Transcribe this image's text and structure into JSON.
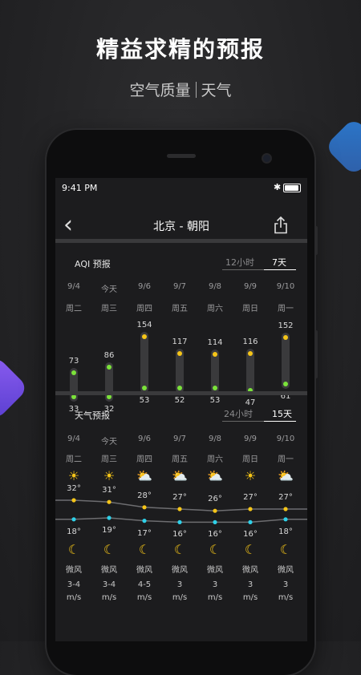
{
  "promo": {
    "headline": "精益求精的预报",
    "sub_left": "空气质量",
    "sub_right": "天气"
  },
  "status_bar": {
    "time": "9:41 PM",
    "bluetooth": "✱"
  },
  "nav": {
    "back_icon": "‹",
    "title": "北京 - 朝阳"
  },
  "aqi": {
    "title": "AQI 预报",
    "toggle": [
      "12小时",
      "7天"
    ],
    "active": "7天",
    "days": [
      {
        "date": "9/4",
        "weekday": "周二",
        "high": "73",
        "low": "33",
        "hi_color": "#7be23a",
        "lo_color": "#7be23a"
      },
      {
        "date": "今天",
        "weekday": "周三",
        "high": "86",
        "low": "32",
        "hi_color": "#7be23a",
        "lo_color": "#7be23a"
      },
      {
        "date": "9/6",
        "weekday": "周四",
        "high": "154",
        "low": "53",
        "hi_color": "#f5c518",
        "lo_color": "#7be23a"
      },
      {
        "date": "9/7",
        "weekday": "周五",
        "high": "117",
        "low": "52",
        "hi_color": "#f5c518",
        "lo_color": "#7be23a"
      },
      {
        "date": "9/8",
        "weekday": "周六",
        "high": "114",
        "low": "53",
        "hi_color": "#f5c518",
        "lo_color": "#7be23a"
      },
      {
        "date": "9/9",
        "weekday": "周日",
        "high": "116",
        "low": "47",
        "hi_color": "#f5c518",
        "lo_color": "#7be23a"
      },
      {
        "date": "9/10",
        "weekday": "周一",
        "high": "152",
        "low": "61",
        "hi_color": "#f5c518",
        "lo_color": "#7be23a"
      }
    ]
  },
  "weather": {
    "title": "天气预报",
    "toggle": [
      "24小时",
      "15天"
    ],
    "active": "15天",
    "days": [
      {
        "date": "9/4",
        "weekday": "周二",
        "day_icon": "sun",
        "night_icon": "moon",
        "high": "32°",
        "low": "18°",
        "wind": "微风",
        "speed": "3-4",
        "unit": "m/s"
      },
      {
        "date": "今天",
        "weekday": "周三",
        "day_icon": "sun",
        "night_icon": "moon-cloud",
        "high": "31°",
        "low": "19°",
        "wind": "微风",
        "speed": "3-4",
        "unit": "m/s"
      },
      {
        "date": "9/6",
        "weekday": "周四",
        "day_icon": "sun-cloud",
        "night_icon": "moon",
        "high": "28°",
        "low": "17°",
        "wind": "微风",
        "speed": "4-5",
        "unit": "m/s"
      },
      {
        "date": "9/7",
        "weekday": "周五",
        "day_icon": "sun-cloud",
        "night_icon": "moon-cloud",
        "high": "27°",
        "low": "16°",
        "wind": "微风",
        "speed": "3",
        "unit": "m/s"
      },
      {
        "date": "9/8",
        "weekday": "周六",
        "day_icon": "sun-cloud",
        "night_icon": "moon-cloud",
        "high": "26°",
        "low": "16°",
        "wind": "微风",
        "speed": "3",
        "unit": "m/s"
      },
      {
        "date": "9/9",
        "weekday": "周日",
        "day_icon": "sun",
        "night_icon": "moon-cloud",
        "high": "27°",
        "low": "16°",
        "wind": "微风",
        "speed": "3",
        "unit": "m/s"
      },
      {
        "date": "9/10",
        "weekday": "周一",
        "day_icon": "sun-cloud",
        "night_icon": "moon-cloud",
        "high": "27°",
        "low": "18°",
        "wind": "微风",
        "speed": "3",
        "unit": "m/s"
      }
    ],
    "high_color": "#f5c518",
    "low_color": "#2ed0e8"
  },
  "colors": {
    "accent_green": "#7be23a",
    "accent_yellow": "#f5c518",
    "accent_cyan": "#2ed0e8",
    "deco_blue": "#2b76c9",
    "deco_purple": "#7a4ee8"
  }
}
